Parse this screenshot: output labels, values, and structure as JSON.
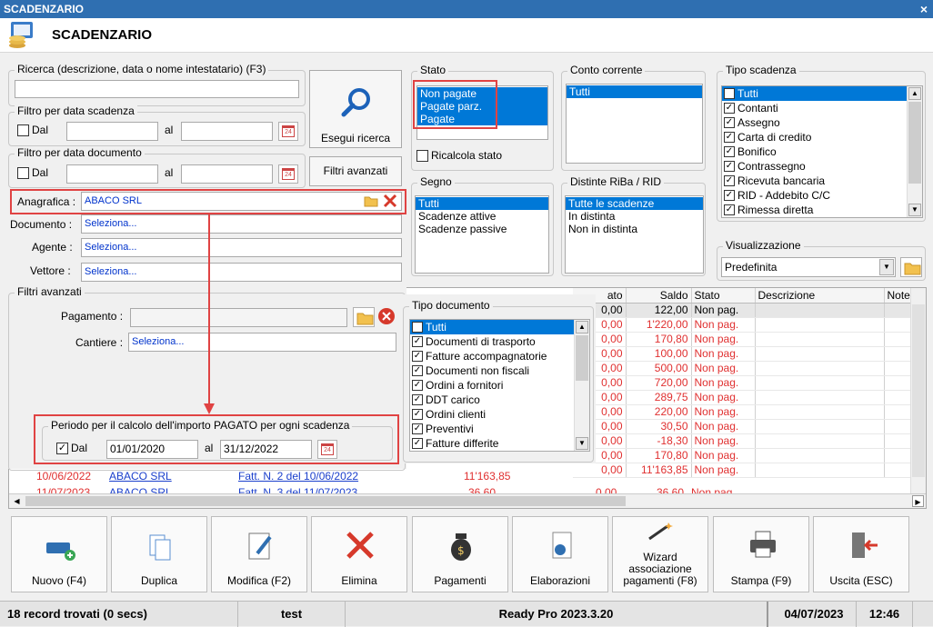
{
  "window": {
    "title": "SCADENZARIO",
    "close": "×"
  },
  "header": {
    "title": "SCADENZARIO"
  },
  "search": {
    "label": "Ricerca (descrizione, data o nome intestatario) (F3)",
    "value": "",
    "button": "Esegui ricerca"
  },
  "filtro_scadenza": {
    "label": "Filtro per data scadenza",
    "dal": "Dal",
    "al": "al",
    "from": "",
    "to": ""
  },
  "filtro_documento": {
    "label": "Filtro per data documento",
    "dal": "Dal",
    "al": "al",
    "from": "",
    "to": ""
  },
  "filtri_avanzati_button": "Filtri avanzati",
  "anagrafica": {
    "label": "Anagrafica :",
    "value": "ABACO SRL"
  },
  "documento": {
    "label": "Documento :",
    "value": "Seleziona..."
  },
  "agente": {
    "label": "Agente :",
    "value": "Seleziona..."
  },
  "vettore": {
    "label": "Vettore :",
    "value": "Seleziona..."
  },
  "stato": {
    "label": "Stato",
    "items": [
      "Non pagate",
      "Pagate parz.",
      "Pagate"
    ],
    "ricalcola": "Ricalcola stato"
  },
  "conto": {
    "label": "Conto corrente",
    "items": [
      "Tutti"
    ]
  },
  "tipo_scadenza": {
    "label": "Tipo scadenza",
    "items": [
      "Tutti",
      "Contanti",
      "Assegno",
      "Carta di credito",
      "Bonifico",
      "Contrassegno",
      "Ricevuta bancaria",
      "RID - Addebito C/C",
      "Rimessa diretta"
    ]
  },
  "segno": {
    "label": "Segno",
    "items": [
      "Tutti",
      "Scadenze attive",
      "Scadenze passive"
    ]
  },
  "distinte": {
    "label": "Distinte RiBa / RID",
    "items": [
      "Tutte le scadenze",
      "In distinta",
      "Non in distinta"
    ]
  },
  "visualizzazione": {
    "label": "Visualizzazione",
    "value": "Predefinita"
  },
  "filtri_avanzati": {
    "label": "Filtri avanzati",
    "pagamento": "Pagamento :",
    "cantiere": "Cantiere :",
    "cantiere_value": "Seleziona...",
    "periodo": {
      "label": "Periodo per il calcolo dell'importo PAGATO per ogni scadenza",
      "dal": "Dal",
      "al": "al",
      "from": "01/01/2020",
      "to": "31/12/2022"
    }
  },
  "tipo_documento": {
    "label": "Tipo documento",
    "items": [
      "Tutti",
      "Documenti di trasporto",
      "Fatture accompagnatorie",
      "Documenti non fiscali",
      "Ordini a fornitori",
      "DDT carico",
      "Ordini clienti",
      "Preventivi",
      "Fatture differite"
    ]
  },
  "grid": {
    "columns": [
      "ato",
      "Saldo",
      "Stato",
      "Descrizione",
      "Note"
    ],
    "rows": [
      {
        "pagato": "0,00",
        "saldo": "122,00",
        "stato": "Non pag."
      },
      {
        "pagato": "0,00",
        "saldo": "1'220,00",
        "stato": "Non pag."
      },
      {
        "pagato": "0,00",
        "saldo": "170,80",
        "stato": "Non pag."
      },
      {
        "pagato": "0,00",
        "saldo": "100,00",
        "stato": "Non pag."
      },
      {
        "pagato": "0,00",
        "saldo": "500,00",
        "stato": "Non pag."
      },
      {
        "pagato": "0,00",
        "saldo": "720,00",
        "stato": "Non pag."
      },
      {
        "pagato": "0,00",
        "saldo": "289,75",
        "stato": "Non pag."
      },
      {
        "pagato": "0,00",
        "saldo": "220,00",
        "stato": "Non pag."
      },
      {
        "pagato": "0,00",
        "saldo": "30,50",
        "stato": "Non pag."
      },
      {
        "pagato": "0,00",
        "saldo": "-18,30",
        "stato": "Non pag."
      },
      {
        "pagato": "0,00",
        "saldo": "170,80",
        "stato": "Non pag."
      },
      {
        "pagato": "0,00",
        "saldo": "11'163,85",
        "stato": "Non pag."
      }
    ],
    "partial_row": {
      "data": "10/06/2022",
      "anag": "ABACO SRL",
      "doc": "Fatt. N. 2 del 10/06/2022",
      "importo": "11'163,85"
    },
    "partial_row2": {
      "data": "11/07/2023",
      "anag": "ABACO SRL",
      "doc": "Fatt. N. 3 del 11/07/2023",
      "importo": "36,60",
      "pagato": "0,00",
      "saldo": "36,60",
      "stato": "Non pag."
    }
  },
  "buttons": [
    "Nuovo (F4)",
    "Duplica",
    "Modifica (F2)",
    "Elimina",
    "Pagamenti",
    "Elaborazioni",
    "Wizard associazione pagamenti (F8)",
    "Stampa (F9)",
    "Uscita (ESC)"
  ],
  "status": {
    "records": "18 record trovati (0 secs)",
    "user": "test",
    "version": "Ready Pro 2023.3.20",
    "date": "04/07/2023",
    "time": "12:46"
  }
}
